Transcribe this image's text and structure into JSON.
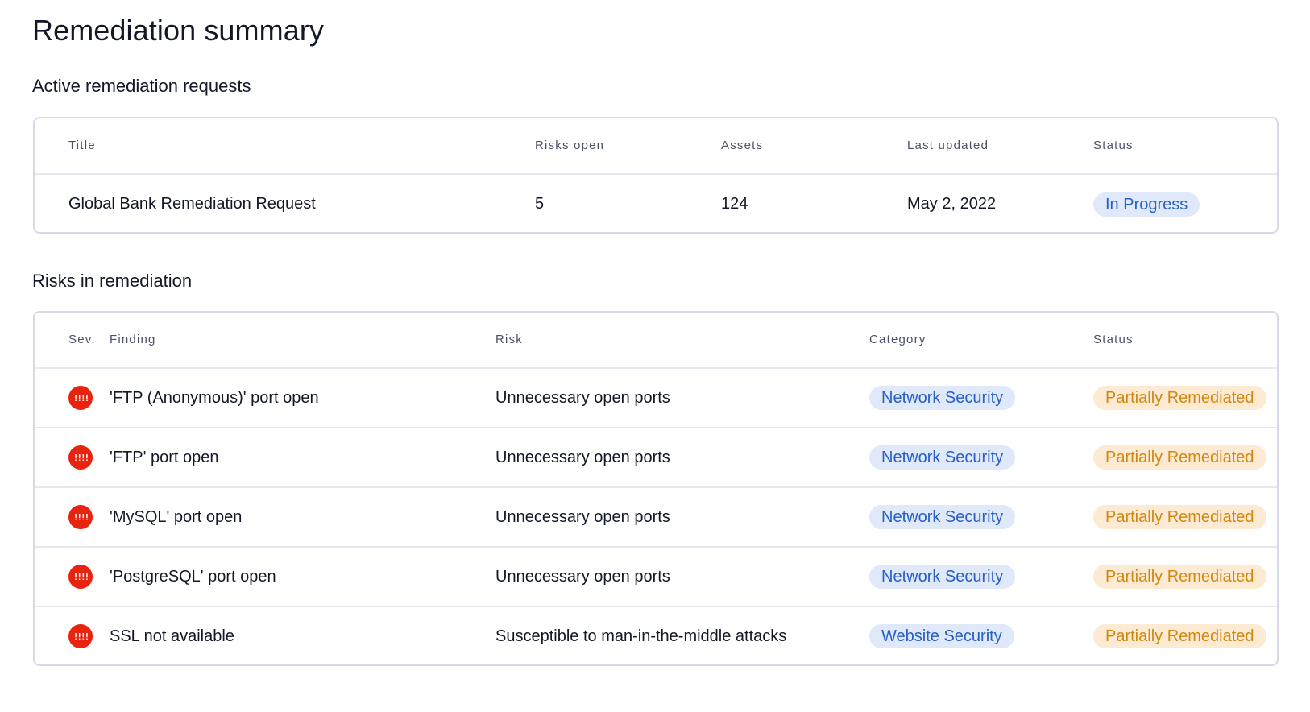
{
  "page": {
    "title": "Remediation summary"
  },
  "active_requests": {
    "heading": "Active remediation requests",
    "columns": {
      "title": "Title",
      "risks_open": "Risks open",
      "assets": "Assets",
      "last_updated": "Last updated",
      "status": "Status"
    },
    "rows": [
      {
        "title": "Global Bank Remediation Request",
        "risks_open": "5",
        "assets": "124",
        "last_updated": "May 2, 2022",
        "status": "In Progress"
      }
    ]
  },
  "risks": {
    "heading": "Risks in remediation",
    "columns": {
      "severity": "Sev.",
      "finding": "Finding",
      "risk": "Risk",
      "category": "Category",
      "status": "Status"
    },
    "rows": [
      {
        "severity_icon": "critical-severity-icon",
        "severity_glyph": "!!!!",
        "finding": "'FTP (Anonymous)' port open",
        "risk": "Unnecessary open ports",
        "category": "Network Security",
        "status": "Partially Remediated"
      },
      {
        "severity_icon": "critical-severity-icon",
        "severity_glyph": "!!!!",
        "finding": "'FTP' port open",
        "risk": "Unnecessary open ports",
        "category": "Network Security",
        "status": "Partially Remediated"
      },
      {
        "severity_icon": "critical-severity-icon",
        "severity_glyph": "!!!!",
        "finding": "'MySQL' port open",
        "risk": "Unnecessary open ports",
        "category": "Network Security",
        "status": "Partially Remediated"
      },
      {
        "severity_icon": "critical-severity-icon",
        "severity_glyph": "!!!!",
        "finding": "'PostgreSQL' port open",
        "risk": "Unnecessary open ports",
        "category": "Network Security",
        "status": "Partially Remediated"
      },
      {
        "severity_icon": "critical-severity-icon",
        "severity_glyph": "!!!!",
        "finding": "SSL not available",
        "risk": "Susceptible to man-in-the-middle attacks",
        "category": "Website Security",
        "status": "Partially Remediated"
      }
    ]
  },
  "colors": {
    "critical": "#e8230f",
    "category_pill_bg": "#dfe9f9",
    "category_pill_text": "#2860c5",
    "partial_pill_bg": "#fcebd2",
    "partial_pill_text": "#d3870f",
    "border": "#d7dae6"
  }
}
